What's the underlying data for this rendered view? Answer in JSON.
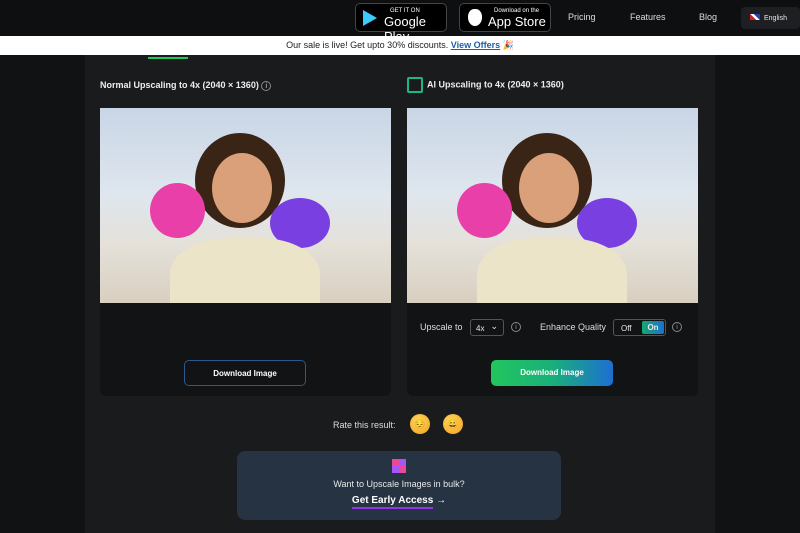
{
  "header": {
    "google_play": {
      "small": "GET IT ON",
      "big": "Google Play"
    },
    "app_store": {
      "small": "Download on the",
      "big": "App Store"
    },
    "nav": [
      "Pricing",
      "Features",
      "Blog"
    ],
    "language": "English"
  },
  "banner": {
    "text": "Our sale is live! Get upto 30% discounts.",
    "link": "View Offers",
    "emoji": "🎉"
  },
  "normal": {
    "title": "Normal Upscaling to 4x (2040 × 1360)",
    "download": "Download Image"
  },
  "ai": {
    "title": "AI Upscaling to 4x (2040 × 1360)",
    "upscale_label": "Upscale to",
    "upscale_value": "4x",
    "enhance_label": "Enhance Quality",
    "off": "Off",
    "on": "On",
    "enhance_state": "On",
    "download": "Download Image"
  },
  "rating": {
    "label": "Rate this result:",
    "options": [
      "😔",
      "😀"
    ]
  },
  "bulk": {
    "text": "Want to Upscale Images in bulk?",
    "cta": "Get Early Access",
    "arrow": "→"
  },
  "colors": {
    "accent_green": "#22c55e",
    "accent_blue": "#1d6fd1",
    "cta_underline": "#9333ea"
  }
}
